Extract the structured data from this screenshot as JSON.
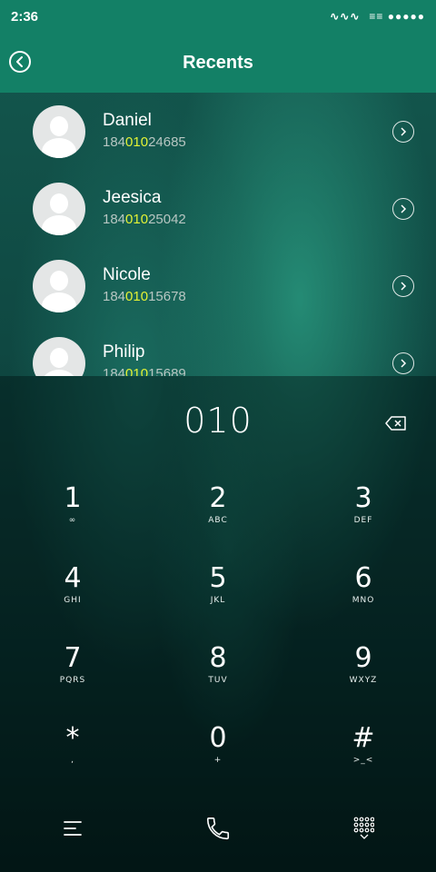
{
  "status_bar": {
    "time": "2:36",
    "signal_text": "∿∿∿",
    "battery_text": "≡≡ ●●●●●"
  },
  "header": {
    "title": "Recents",
    "back_icon": "back-circle-icon"
  },
  "contacts": [
    {
      "name": "Daniel",
      "number_prefix": "184",
      "number_match": "010",
      "number_suffix": "24685"
    },
    {
      "name": "Jeesica",
      "number_prefix": "184",
      "number_match": "010",
      "number_suffix": "25042"
    },
    {
      "name": "Nicole",
      "number_prefix": "184",
      "number_match": "010",
      "number_suffix": "15678"
    },
    {
      "name": "Philip",
      "number_prefix": "184",
      "number_match": "010",
      "number_suffix": "15689"
    }
  ],
  "dialer": {
    "input_value": "010",
    "keys": [
      {
        "digit": "1",
        "letters": "∞"
      },
      {
        "digit": "2",
        "letters": "ABC"
      },
      {
        "digit": "3",
        "letters": "DEF"
      },
      {
        "digit": "4",
        "letters": "GHI"
      },
      {
        "digit": "5",
        "letters": "JKL"
      },
      {
        "digit": "6",
        "letters": "MNO"
      },
      {
        "digit": "7",
        "letters": "PQRS"
      },
      {
        "digit": "8",
        "letters": "TUV"
      },
      {
        "digit": "9",
        "letters": "WXYZ"
      },
      {
        "digit": "*",
        "letters": ","
      },
      {
        "digit": "0",
        "letters": "+"
      },
      {
        "digit": "#",
        "letters": ">_<"
      }
    ]
  },
  "bottom_bar": {
    "left_icon": "menu-icon",
    "center_icon": "phone-icon",
    "right_icon": "dialpad-icon"
  },
  "colors": {
    "header_bg": "#138066",
    "highlight": "#e3f235"
  }
}
